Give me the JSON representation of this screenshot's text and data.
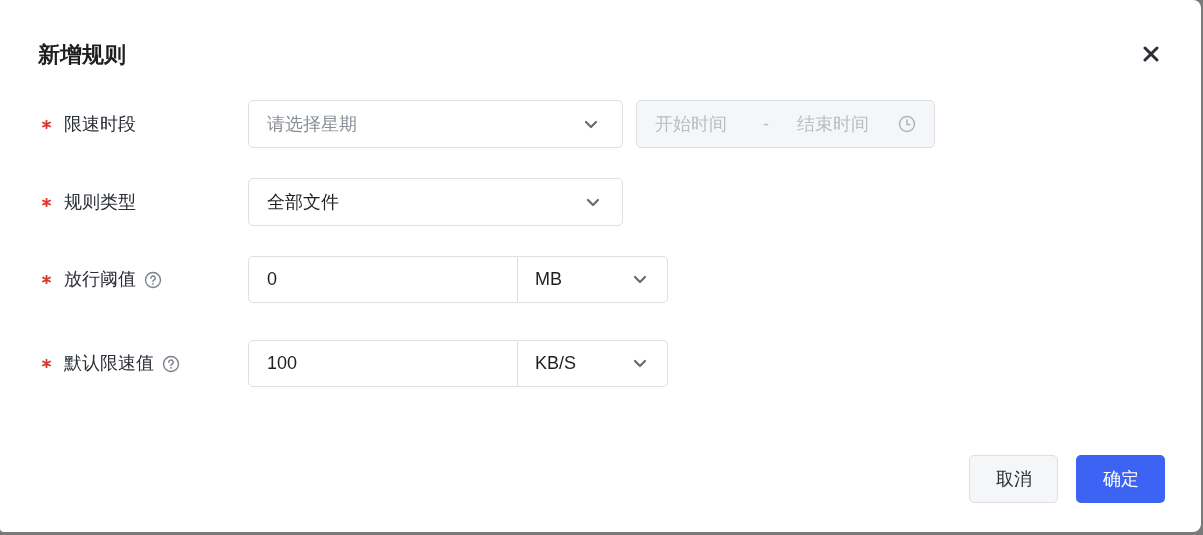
{
  "dialog": {
    "title": "新增规则"
  },
  "fields": [
    {
      "kind": "weekday-time",
      "label": "限速时段",
      "required": true,
      "help": false,
      "select": {
        "placeholder": "请选择星期"
      },
      "time_range": {
        "start_placeholder": "开始时间",
        "separator": "-",
        "end_placeholder": "结束时间",
        "disabled": true
      }
    },
    {
      "kind": "select",
      "label": "规则类型",
      "required": true,
      "help": false,
      "value": "全部文件"
    },
    {
      "kind": "number-unit",
      "label": "放行阈值",
      "required": true,
      "help": true,
      "value": "0",
      "unit": "MB"
    },
    {
      "kind": "number-unit",
      "label": "默认限速值",
      "required": true,
      "help": true,
      "value": "100",
      "unit": "KB/S"
    }
  ],
  "buttons": [
    {
      "label": "取消",
      "primary": false
    },
    {
      "label": "确定",
      "primary": true
    }
  ]
}
